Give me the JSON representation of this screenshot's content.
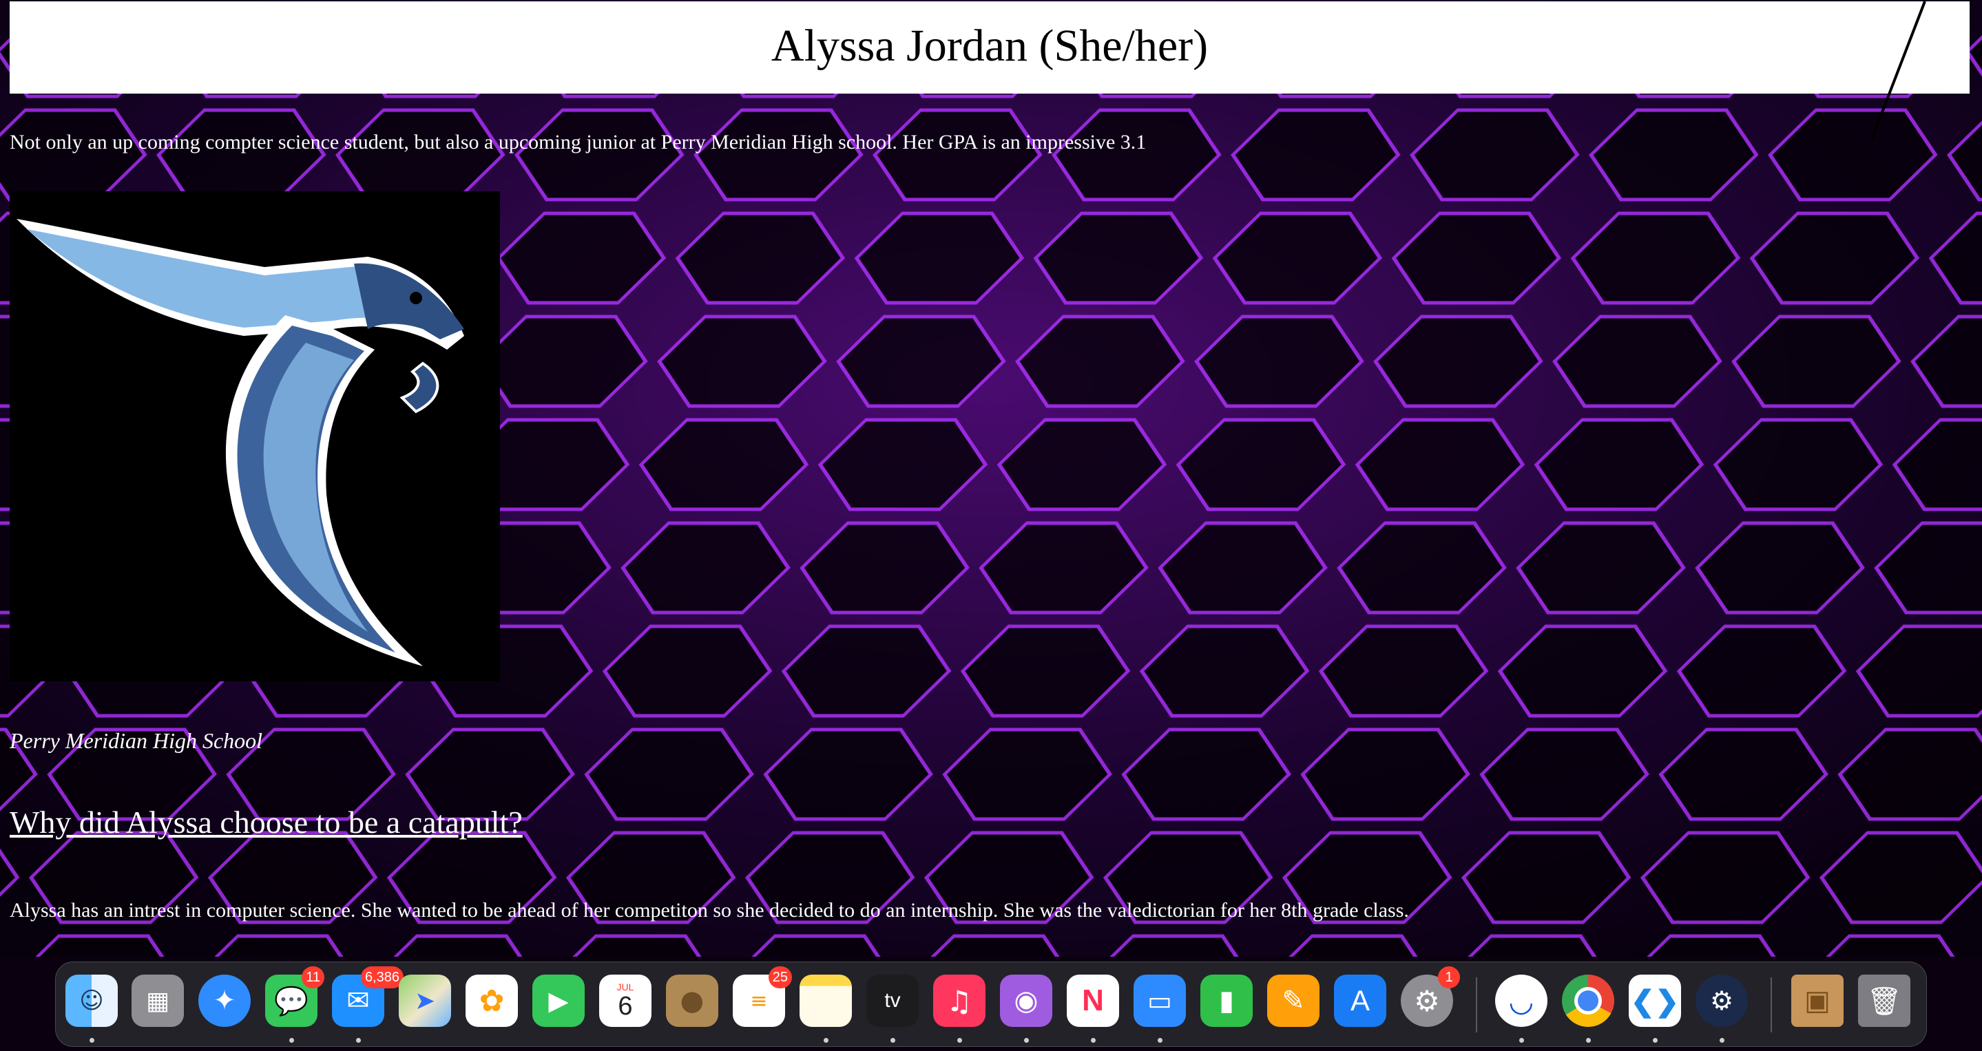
{
  "page": {
    "title": "Alyssa Jordan (She/her)",
    "intro": "Not only an up coming compter science student, but also a upcoming junior at Perry Meridian High school. Her GPA is an impressive 3.1",
    "logo_caption": "Perry Meridian High School",
    "heading": "Why did Alyssa choose to be a catapult?",
    "paragraph": "Alyssa has an intrest in computer science. She wanted to be ahead of her competiton so she decided to do an internship. She was the valedictorian for her 8th grade class."
  },
  "colors": {
    "accent": "#b030ff",
    "background": "#0a0010",
    "title_bar": "#ffffff"
  },
  "dock": {
    "apps": [
      {
        "name": "Finder",
        "icon": "finder-icon",
        "running": true
      },
      {
        "name": "Launchpad",
        "icon": "launchpad-icon",
        "running": false
      },
      {
        "name": "Safari",
        "icon": "safari-icon",
        "running": false
      },
      {
        "name": "Messages",
        "icon": "messages-icon",
        "badge": "11",
        "running": true
      },
      {
        "name": "Mail",
        "icon": "mail-icon",
        "badge": "6,386",
        "running": true
      },
      {
        "name": "Maps",
        "icon": "maps-icon",
        "running": false
      },
      {
        "name": "Photos",
        "icon": "photos-icon",
        "running": false
      },
      {
        "name": "FaceTime",
        "icon": "facetime-icon",
        "running": false
      },
      {
        "name": "Calendar",
        "icon": "calendar-icon",
        "month": "JUL",
        "day": "6",
        "running": false
      },
      {
        "name": "Contacts",
        "icon": "contacts-icon",
        "running": false
      },
      {
        "name": "Reminders",
        "icon": "reminders-icon",
        "badge": "25",
        "running": false
      },
      {
        "name": "Notes",
        "icon": "notes-icon",
        "running": true
      },
      {
        "name": "TV",
        "icon": "apple-tv-icon",
        "label": "tv",
        "running": true
      },
      {
        "name": "Music",
        "icon": "music-icon",
        "running": true
      },
      {
        "name": "Podcasts",
        "icon": "podcasts-icon",
        "running": true
      },
      {
        "name": "News",
        "icon": "news-icon",
        "running": true
      },
      {
        "name": "Keynote",
        "icon": "keynote-icon",
        "running": true
      },
      {
        "name": "Numbers",
        "icon": "numbers-icon",
        "running": false
      },
      {
        "name": "Pages",
        "icon": "pages-icon",
        "running": false
      },
      {
        "name": "App Store",
        "icon": "app-store-icon",
        "running": false
      },
      {
        "name": "System Preferences",
        "icon": "system-preferences-icon",
        "badge": "1",
        "running": false
      },
      {
        "name": "Webex",
        "icon": "webex-icon",
        "running": true
      },
      {
        "name": "Chrome",
        "icon": "chrome-icon",
        "running": true
      },
      {
        "name": "Visual Studio Code",
        "icon": "vscode-icon",
        "running": true
      },
      {
        "name": "Steam",
        "icon": "steam-icon",
        "running": true
      },
      {
        "name": "Installer",
        "icon": "package-icon",
        "running": false
      },
      {
        "name": "Trash",
        "icon": "trash-icon",
        "running": false
      }
    ]
  }
}
